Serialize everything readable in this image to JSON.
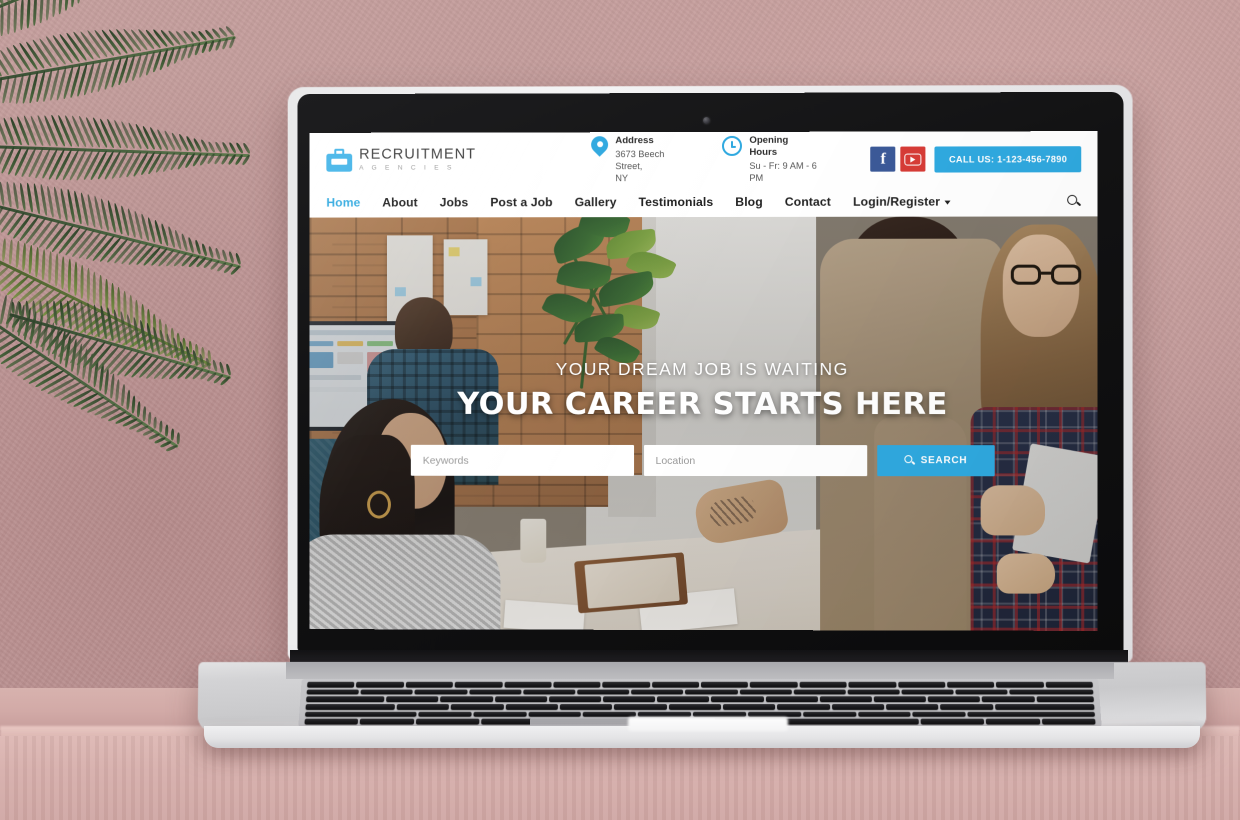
{
  "scene": {
    "description": "laptop-on-pink-table-with-palm-plant",
    "wall_color": "#c29a9a",
    "table_color": "#d6aeab",
    "plant_color": "#3d5634"
  },
  "device": {
    "type": "laptop",
    "bezel_color": "#121213",
    "body_color": "#d3d3d5",
    "webcam": "webcam-dot"
  },
  "site": {
    "accent_color": "#2fa9e0",
    "header": {
      "logo": {
        "icon": "briefcase-icon",
        "name": "RECRUITMENT",
        "subtitle": "A G E N C I E S"
      },
      "address": {
        "icon": "map-pin-icon",
        "title": "Address",
        "line1": "3673 Beech Street,",
        "line2": "NY"
      },
      "hours": {
        "icon": "clock-icon",
        "title": "Opening Hours",
        "line1": "Su - Fr: 9 AM - 6 PM"
      },
      "social": [
        {
          "name": "facebook-icon",
          "glyph": "f",
          "color": "#3b5998"
        },
        {
          "name": "youtube-icon",
          "glyph": "▶",
          "color": "#d73b36"
        }
      ],
      "call_button": "CALL US: 1-123-456-7890",
      "search_icon": "search-icon"
    },
    "nav": {
      "items": [
        {
          "label": "Home",
          "active": true,
          "dropdown": false
        },
        {
          "label": "About",
          "active": false,
          "dropdown": false
        },
        {
          "label": "Jobs",
          "active": false,
          "dropdown": false
        },
        {
          "label": "Post a Job",
          "active": false,
          "dropdown": false
        },
        {
          "label": "Gallery",
          "active": false,
          "dropdown": false
        },
        {
          "label": "Testimonials",
          "active": false,
          "dropdown": false
        },
        {
          "label": "Blog",
          "active": false,
          "dropdown": false
        },
        {
          "label": "Contact",
          "active": false,
          "dropdown": false
        },
        {
          "label": "Login/Register",
          "active": false,
          "dropdown": true
        }
      ]
    },
    "hero": {
      "subtitle": "YOUR DREAM JOB IS WAITING",
      "title": "YOUR CAREER STARTS HERE",
      "search": {
        "keywords_placeholder": "Keywords",
        "keywords_value": "",
        "location_placeholder": "Location",
        "location_value": "",
        "button_label": "SEARCH",
        "button_icon": "search-icon"
      },
      "background": "office-team-meeting-photo"
    }
  }
}
